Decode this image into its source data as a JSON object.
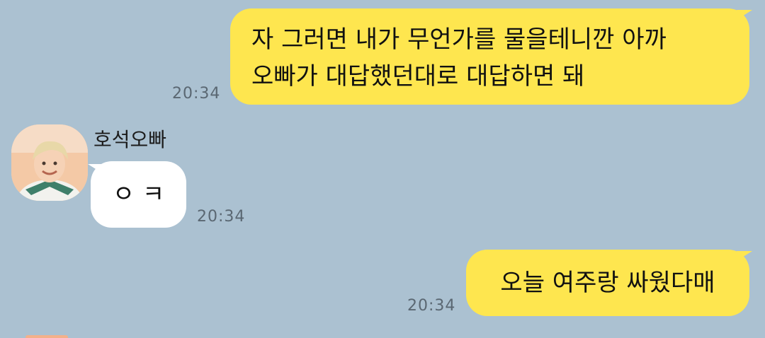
{
  "messages": [
    {
      "side": "me",
      "lines": [
        "자 그러면 내가 무언가를 물을테니깐 아까",
        "오빠가 대답했던대로 대답하면 돼"
      ],
      "time": "20:34"
    },
    {
      "side": "them",
      "sender": "호석오빠",
      "text": "ㅇ ㅋ",
      "time": "20:34"
    },
    {
      "side": "me",
      "text": "오늘 여주랑 싸웠다매",
      "time": "20:34"
    }
  ],
  "colors": {
    "background": "#abc1d1",
    "my_bubble": "#fee64f",
    "their_bubble": "#ffffff",
    "timestamp": "#5a6772"
  },
  "icons": {
    "avatar": "profile-photo"
  }
}
